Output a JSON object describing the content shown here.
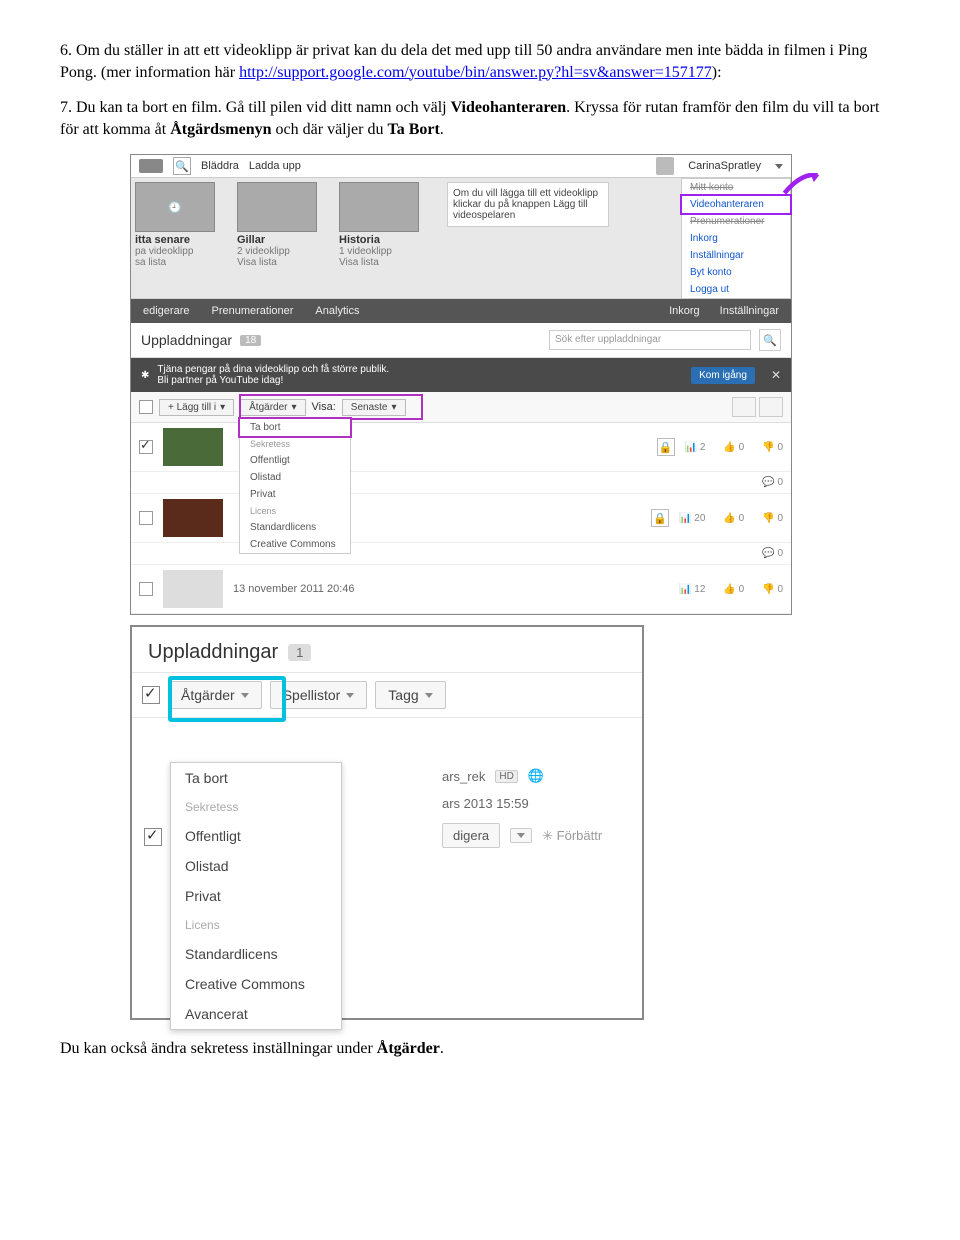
{
  "doc": {
    "item6_num": "6.",
    "item6_a": "Om du ställer in att ett videoklipp är privat kan du dela det med upp till 50 andra användare men inte bädda in filmen i Ping Pong. (mer information här ",
    "item6_link": "http://support.google.com/youtube/bin/answer.py?hl=sv&answer=157177",
    "item6_b": "):",
    "item7_num": "7.",
    "item7_a": "Du kan ta bort en film. Gå till pilen vid ditt namn och välj ",
    "item7_b": "Videohanteraren",
    "item7_c": ". Kryssa för rutan framför den film du vill ta bort för att komma åt ",
    "item7_d": "Åtgärdsmenyn",
    "item7_e": " och där väljer du ",
    "item7_f": "Ta Bort",
    "item7_g": ".",
    "footer_a": "Du kan också ändra sekretess inställningar under ",
    "footer_b": "Åtgärder",
    "footer_c": "."
  },
  "s1": {
    "top": {
      "bladdra": "Bläddra",
      "ladda": "Ladda upp",
      "user": "CarinaSpratley"
    },
    "tiles": {
      "t1": {
        "title": "itta senare",
        "sub1": "pa videoklipp",
        "sub2": "sa lista"
      },
      "t2": {
        "title": "Gillar",
        "sub1": "2 videoklipp",
        "sub2": "Visa lista"
      },
      "t3": {
        "title": "Historia",
        "sub1": "1 videoklipp",
        "sub2": "Visa lista"
      }
    },
    "tip": "Om du vill lägga till ett videoklipp klickar du på knappen Lägg till videospelaren",
    "menu": {
      "m1": "Mitt konto",
      "m2": "Videohanteraren",
      "m3": "Prenumerationer",
      "m4": "Inkorg",
      "m5": "Inställningar",
      "m6": "Byt konto",
      "m7": "Logga ut"
    },
    "subnav": {
      "a": "edigerare",
      "b": "Prenumerationer",
      "c": "Analytics",
      "d": "Inkorg",
      "e": "Inställningar"
    },
    "upl": {
      "title": "Uppladdningar",
      "count": "18",
      "search_ph": "Sök efter uppladdningar"
    },
    "promo": {
      "l1": "Tjäna pengar på dina videoklipp och få större publik.",
      "l2": "Bli partner på YouTube idag!",
      "btn": "Kom igång"
    },
    "tools": {
      "add": "+ Lägg till i",
      "act": "Åtgärder",
      "visa": "Visa:",
      "sen": "Senaste"
    },
    "dd2": {
      "tabort": "Ta bort",
      "sekr": "Sekretess",
      "off": "Offentligt",
      "oli": "Olistad",
      "priv": "Privat",
      "lic": "Licens",
      "std": "Standardlicens",
      "cc": "Creative Commons"
    },
    "row_date": "13 november 2011 20:46",
    "stats": {
      "v1": "2",
      "v2": "20",
      "v3": "12",
      "like": "0",
      "dis": "0",
      "c": "0"
    }
  },
  "s2": {
    "title": "Uppladdningar",
    "count": "1",
    "btns": {
      "act": "Åtgärder",
      "spel": "Spellistor",
      "tagg": "Tagg"
    },
    "dd": {
      "tabort": "Ta bort",
      "sekr": "Sekretess",
      "off": "Offentligt",
      "oli": "Olistad",
      "priv": "Privat",
      "lic": "Licens",
      "std": "Standardlicens",
      "cc": "Creative Commons",
      "adv": "Avancerat"
    },
    "right": {
      "rek": "ars_rek",
      "hd": "HD",
      "date": "ars 2013 15:59",
      "edit": "digera",
      "forb": "Förbättr"
    }
  }
}
